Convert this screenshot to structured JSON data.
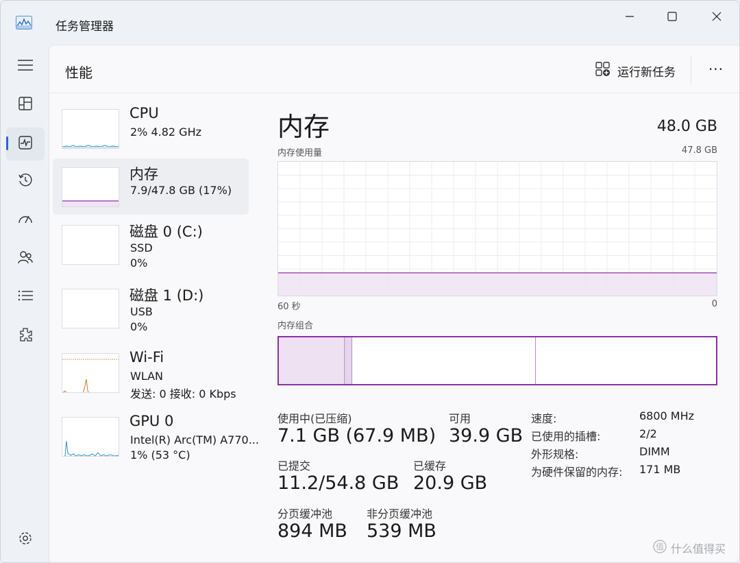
{
  "window": {
    "title": "任务管理器"
  },
  "header": {
    "title": "性能",
    "run_task_label": "运行新任务",
    "more_label": "···"
  },
  "nav": {
    "items": [
      {
        "name": "menu-icon"
      },
      {
        "name": "processes-icon"
      },
      {
        "name": "performance-icon",
        "active": true
      },
      {
        "name": "app-history-icon"
      },
      {
        "name": "startup-icon"
      },
      {
        "name": "users-icon"
      },
      {
        "name": "details-icon"
      },
      {
        "name": "services-icon"
      },
      {
        "name": "settings-icon"
      }
    ]
  },
  "devices": [
    {
      "name": "CPU",
      "line1": "2%  4.82 GHz",
      "line2": ""
    },
    {
      "name": "内存",
      "line1": "7.9/47.8 GB (17%)",
      "line2": ""
    },
    {
      "name": "磁盘 0 (C:)",
      "line1": "SSD",
      "line2": "0%"
    },
    {
      "name": "磁盘 1 (D:)",
      "line1": "USB",
      "line2": "0%"
    },
    {
      "name": "Wi-Fi",
      "line1": "WLAN",
      "line2": "发送: 0  接收: 0 Kbps"
    },
    {
      "name": "GPU 0",
      "line1": "Intel(R) Arc(TM) A770...",
      "line2": "1%  (53 °C)"
    }
  ],
  "memory": {
    "title": "内存",
    "total": "48.0 GB",
    "usage_label": "内存使用量",
    "usage_max": "47.8 GB",
    "axis_left": "60 秒",
    "axis_right": "0",
    "usage_fraction": 0.17,
    "composition_label": "内存组合",
    "composition": {
      "in_use_fraction": 0.15,
      "modified_fraction": 0.017,
      "standby_fraction": 0.42
    },
    "stats": {
      "in_use_label": "使用中(已压缩)",
      "in_use_value": "7.1 GB (67.9 MB)",
      "available_label": "可用",
      "available_value": "39.9 GB",
      "committed_label": "已提交",
      "committed_value": "11.2/54.8 GB",
      "cached_label": "已缓存",
      "cached_value": "20.9 GB",
      "paged_label": "分页缓冲池",
      "paged_value": "894 MB",
      "nonpaged_label": "非分页缓冲池",
      "nonpaged_value": "539 MB"
    },
    "specs": [
      {
        "key": "速度:",
        "value": "6800 MHz"
      },
      {
        "key": "已使用的插槽:",
        "value": "2/2"
      },
      {
        "key": "外形规格:",
        "value": "DIMM"
      },
      {
        "key": "为硬件保留的内存:",
        "value": "171 MB"
      }
    ]
  },
  "watermark": "什么值得买",
  "colors": {
    "memory": "#8b2fa6",
    "cpu": "#2b8ad6",
    "wifi": "#c77a32",
    "accent": "#2a64d6"
  }
}
